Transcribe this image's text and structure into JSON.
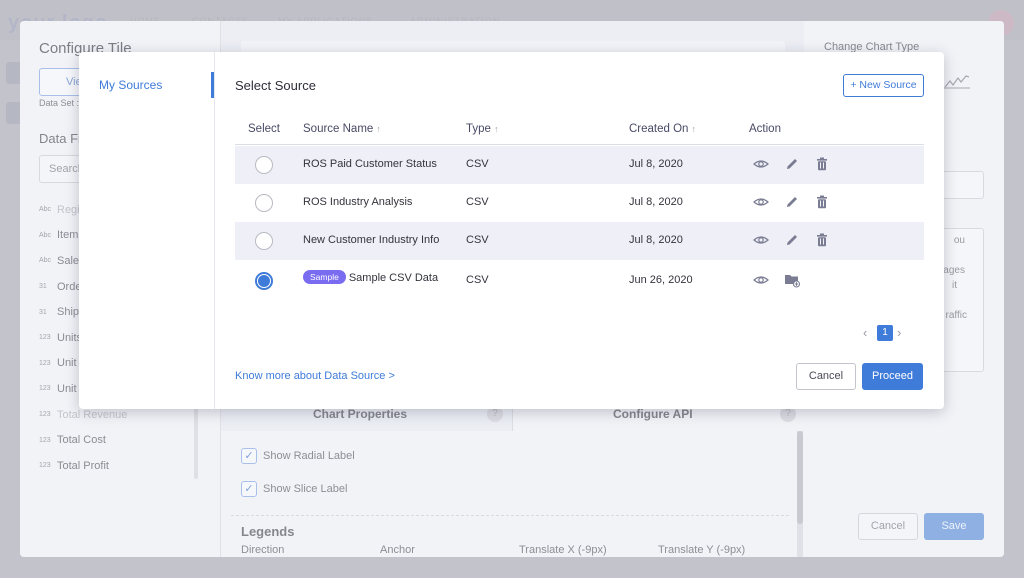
{
  "background_app": {
    "logo": "your logo",
    "nav": [
      "HOME",
      "CONTACTS",
      "MY APPLICATIONS",
      "ADMINISTRATION"
    ]
  },
  "configure_tile": {
    "title": "Configure Tile",
    "view_button": "View",
    "data_set_label": "Data Set :",
    "data_fields_title": "Data Fields",
    "search_placeholder": "Search",
    "fields": [
      {
        "type_icon": "Abc",
        "label": "Region",
        "faded": true
      },
      {
        "type_icon": "Abc",
        "label": "Item Type",
        "faded": false
      },
      {
        "type_icon": "Abc",
        "label": "Sales Channel",
        "faded": false
      },
      {
        "type_icon": "31",
        "label": "Order Date",
        "faded": false
      },
      {
        "type_icon": "31",
        "label": "Ship Date",
        "faded": false
      },
      {
        "type_icon": "123",
        "label": "Units Sold",
        "faded": false
      },
      {
        "type_icon": "123",
        "label": "Unit Price",
        "faded": false
      },
      {
        "type_icon": "123",
        "label": "Unit Cost",
        "faded": false
      },
      {
        "type_icon": "123",
        "label": "Total Revenue",
        "faded": true
      },
      {
        "type_icon": "123",
        "label": "Total Cost",
        "faded": false
      },
      {
        "type_icon": "123",
        "label": "Total Profit",
        "faded": false
      }
    ],
    "tabs": {
      "chart_properties": "Chart Properties",
      "configure_api": "Configure API",
      "help": "?"
    },
    "checkboxes": [
      {
        "label": "Show Radial Label",
        "checked": true
      },
      {
        "label": "Show Slice Label",
        "checked": true
      }
    ],
    "legends": {
      "title": "Legends",
      "columns": [
        "Direction",
        "Anchor",
        "Translate X (-9px)",
        "Translate Y (-9px)"
      ]
    },
    "right_panel": {
      "change_chart_type": "Change Chart Type",
      "textarea_fragments": [
        "ou",
        "ntages",
        "it",
        "raffic"
      ]
    },
    "cancel": "Cancel",
    "save": "Save"
  },
  "dialog": {
    "sidebar": {
      "items": [
        {
          "label": "My Sources",
          "active": true
        }
      ]
    },
    "title": "Select Source",
    "new_source_button": "+ New Source",
    "columns": {
      "select": "Select",
      "source_name": "Source Name",
      "type": "Type",
      "created_on": "Created On",
      "action": "Action",
      "sort_icon": "↑"
    },
    "rows": [
      {
        "selected": false,
        "badge": "",
        "name": "ROS Paid Customer Status",
        "type": "CSV",
        "created_on": "Jul 8, 2020",
        "actions": [
          "view",
          "edit",
          "delete"
        ]
      },
      {
        "selected": false,
        "badge": "",
        "name": "ROS Industry Analysis",
        "type": "CSV",
        "created_on": "Jul 8, 2020",
        "actions": [
          "view",
          "edit",
          "delete"
        ]
      },
      {
        "selected": false,
        "badge": "",
        "name": "New Customer Industry Info",
        "type": "CSV",
        "created_on": "Jul 8, 2020",
        "actions": [
          "view",
          "edit",
          "delete"
        ]
      },
      {
        "selected": true,
        "badge": "Sample",
        "name": "Sample CSV Data",
        "type": "CSV",
        "created_on": "Jun 26, 2020",
        "actions": [
          "view",
          "add-to-folder"
        ]
      }
    ],
    "pagination": {
      "prev": "‹",
      "current": "1",
      "next": "›"
    },
    "know_more_link": "Know more about Data Source >",
    "cancel": "Cancel",
    "proceed": "Proceed",
    "colors": {
      "accent": "#3f7bd8",
      "badge": "#7a6cf0",
      "row_shade": "#eeeff7"
    }
  }
}
